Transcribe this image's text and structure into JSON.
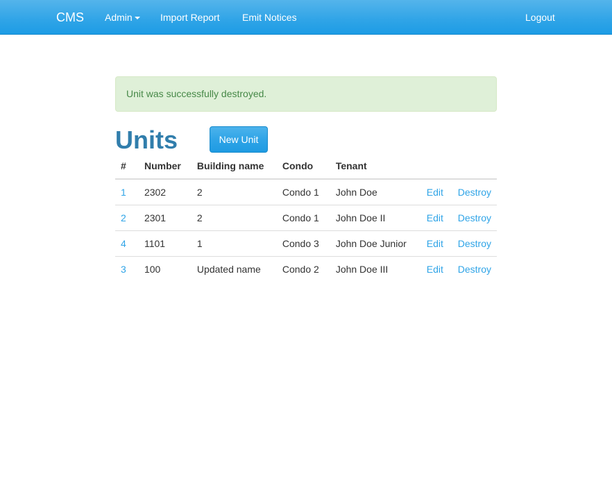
{
  "navbar": {
    "brand": "CMS",
    "admin_label": "Admin",
    "import_label": "Import Report",
    "emit_label": "Emit Notices",
    "logout_label": "Logout"
  },
  "alert": {
    "message": "Unit was successfully destroyed."
  },
  "page": {
    "title": "Units",
    "new_button": "New Unit"
  },
  "table": {
    "headers": [
      "#",
      "Number",
      "Building name",
      "Condo",
      "Tenant"
    ],
    "rows": [
      {
        "id": "1",
        "number": "2302",
        "building": "2",
        "condo": "Condo 1",
        "tenant": "John Doe",
        "edit": "Edit",
        "destroy": "Destroy"
      },
      {
        "id": "2",
        "number": "2301",
        "building": "2",
        "condo": "Condo 1",
        "tenant": "John Doe II",
        "edit": "Edit",
        "destroy": "Destroy"
      },
      {
        "id": "4",
        "number": "1101",
        "building": "1",
        "condo": "Condo 3",
        "tenant": "John Doe Junior",
        "edit": "Edit",
        "destroy": "Destroy"
      },
      {
        "id": "3",
        "number": "100",
        "building": "Updated name",
        "condo": "Condo 2",
        "tenant": "John Doe III",
        "edit": "Edit",
        "destroy": "Destroy"
      }
    ]
  },
  "colors": {
    "navbar": "#2fa4e7",
    "link": "#2fa4e7",
    "title": "#317eac",
    "alert_bg": "#dff0d8",
    "alert_text": "#468847"
  }
}
